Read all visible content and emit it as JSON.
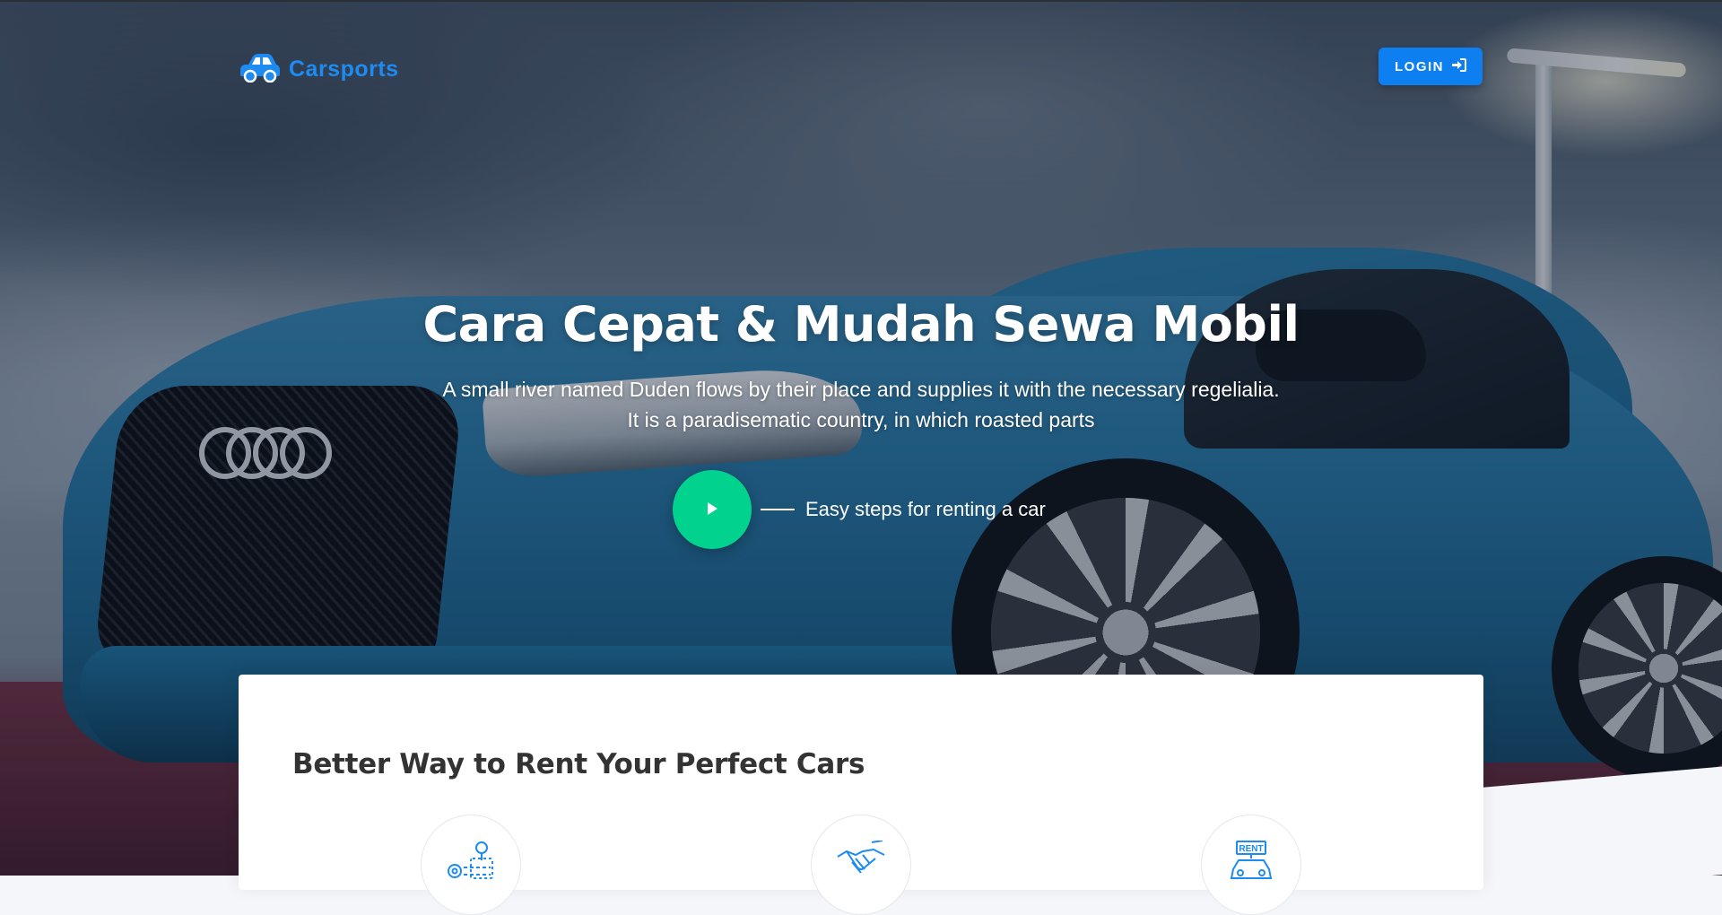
{
  "navbar": {
    "brand_label": "Carsports",
    "brand_icon": "car-icon",
    "login_label": "LOGIN",
    "login_icon": "sign-in-icon"
  },
  "hero": {
    "title": "Cara Cepat & Mudah Sewa Mobil",
    "subtitle": "A small river named Duden flows by their place and supplies it with the necessary regelialia. It is a paradisematic country, in which roasted parts",
    "steps_label": "Easy steps for renting a car",
    "play_icon": "play-icon"
  },
  "section": {
    "title": "Better Way to Rent Your Perfect Cars",
    "feature_icons": [
      "map-route-icon",
      "handshake-icon",
      "rent-car-icon"
    ]
  },
  "colors": {
    "brand": "#1d8bf1",
    "login_button": "#0d7ff1",
    "play_button": "#01d28e",
    "card_title": "#333333"
  }
}
